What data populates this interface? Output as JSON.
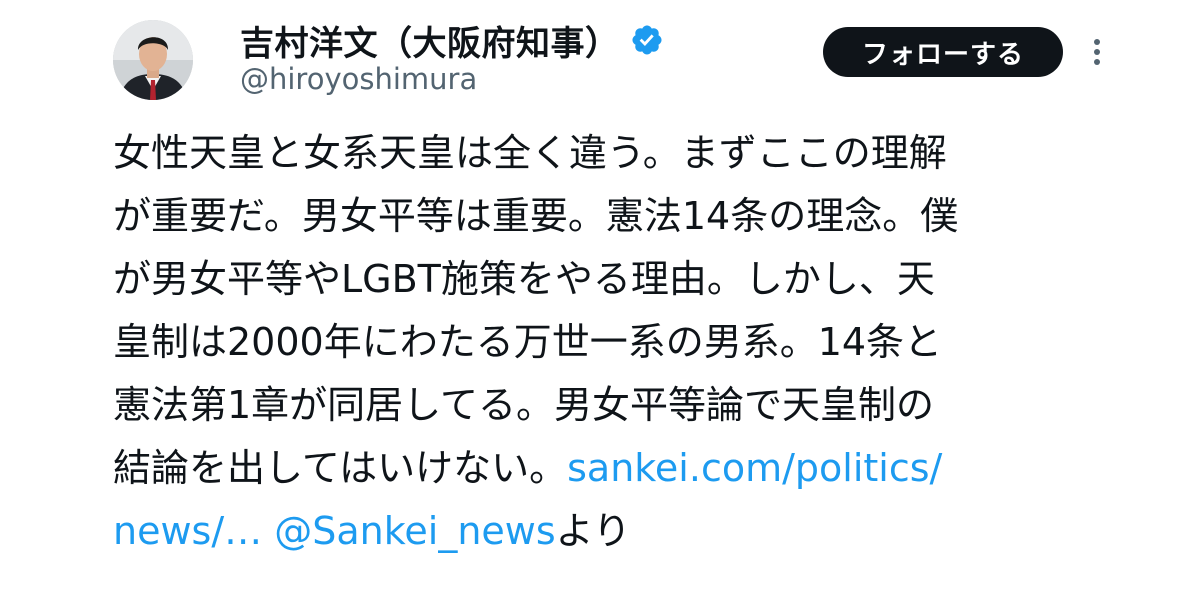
{
  "user": {
    "display_name": "吉村洋文（大阪府知事）",
    "handle": "@hiroyoshimura",
    "verified": true
  },
  "follow_button": {
    "label": "フォローする"
  },
  "tweet": {
    "lines": [
      "女性天皇と女系天皇は全く違う。まずここの理解",
      "が重要だ。男女平等は重要。憲法14条の理念。僕",
      "が男女平等やLGBT施策をやる理由。しかし、天",
      "皇制は2000年にわたる万世一系の男系。14条と",
      "憲法第1章が同居してる。男女平等論で天皇制の"
    ],
    "line6_text": "結論を出してはいけない。",
    "link_url_part1": "sankei.com/politics/",
    "link_url_part2": "news/…",
    "mention": "@Sankei_news",
    "suffix": "より"
  },
  "colors": {
    "link": "#1d9bf0",
    "text": "#0f1419",
    "secondary": "#536471",
    "verified": "#1d9bf0",
    "button_bg": "#0f1419"
  },
  "icons": {
    "verified": "verified-badge-icon",
    "more": "more-vertical-icon",
    "avatar": "avatar"
  }
}
